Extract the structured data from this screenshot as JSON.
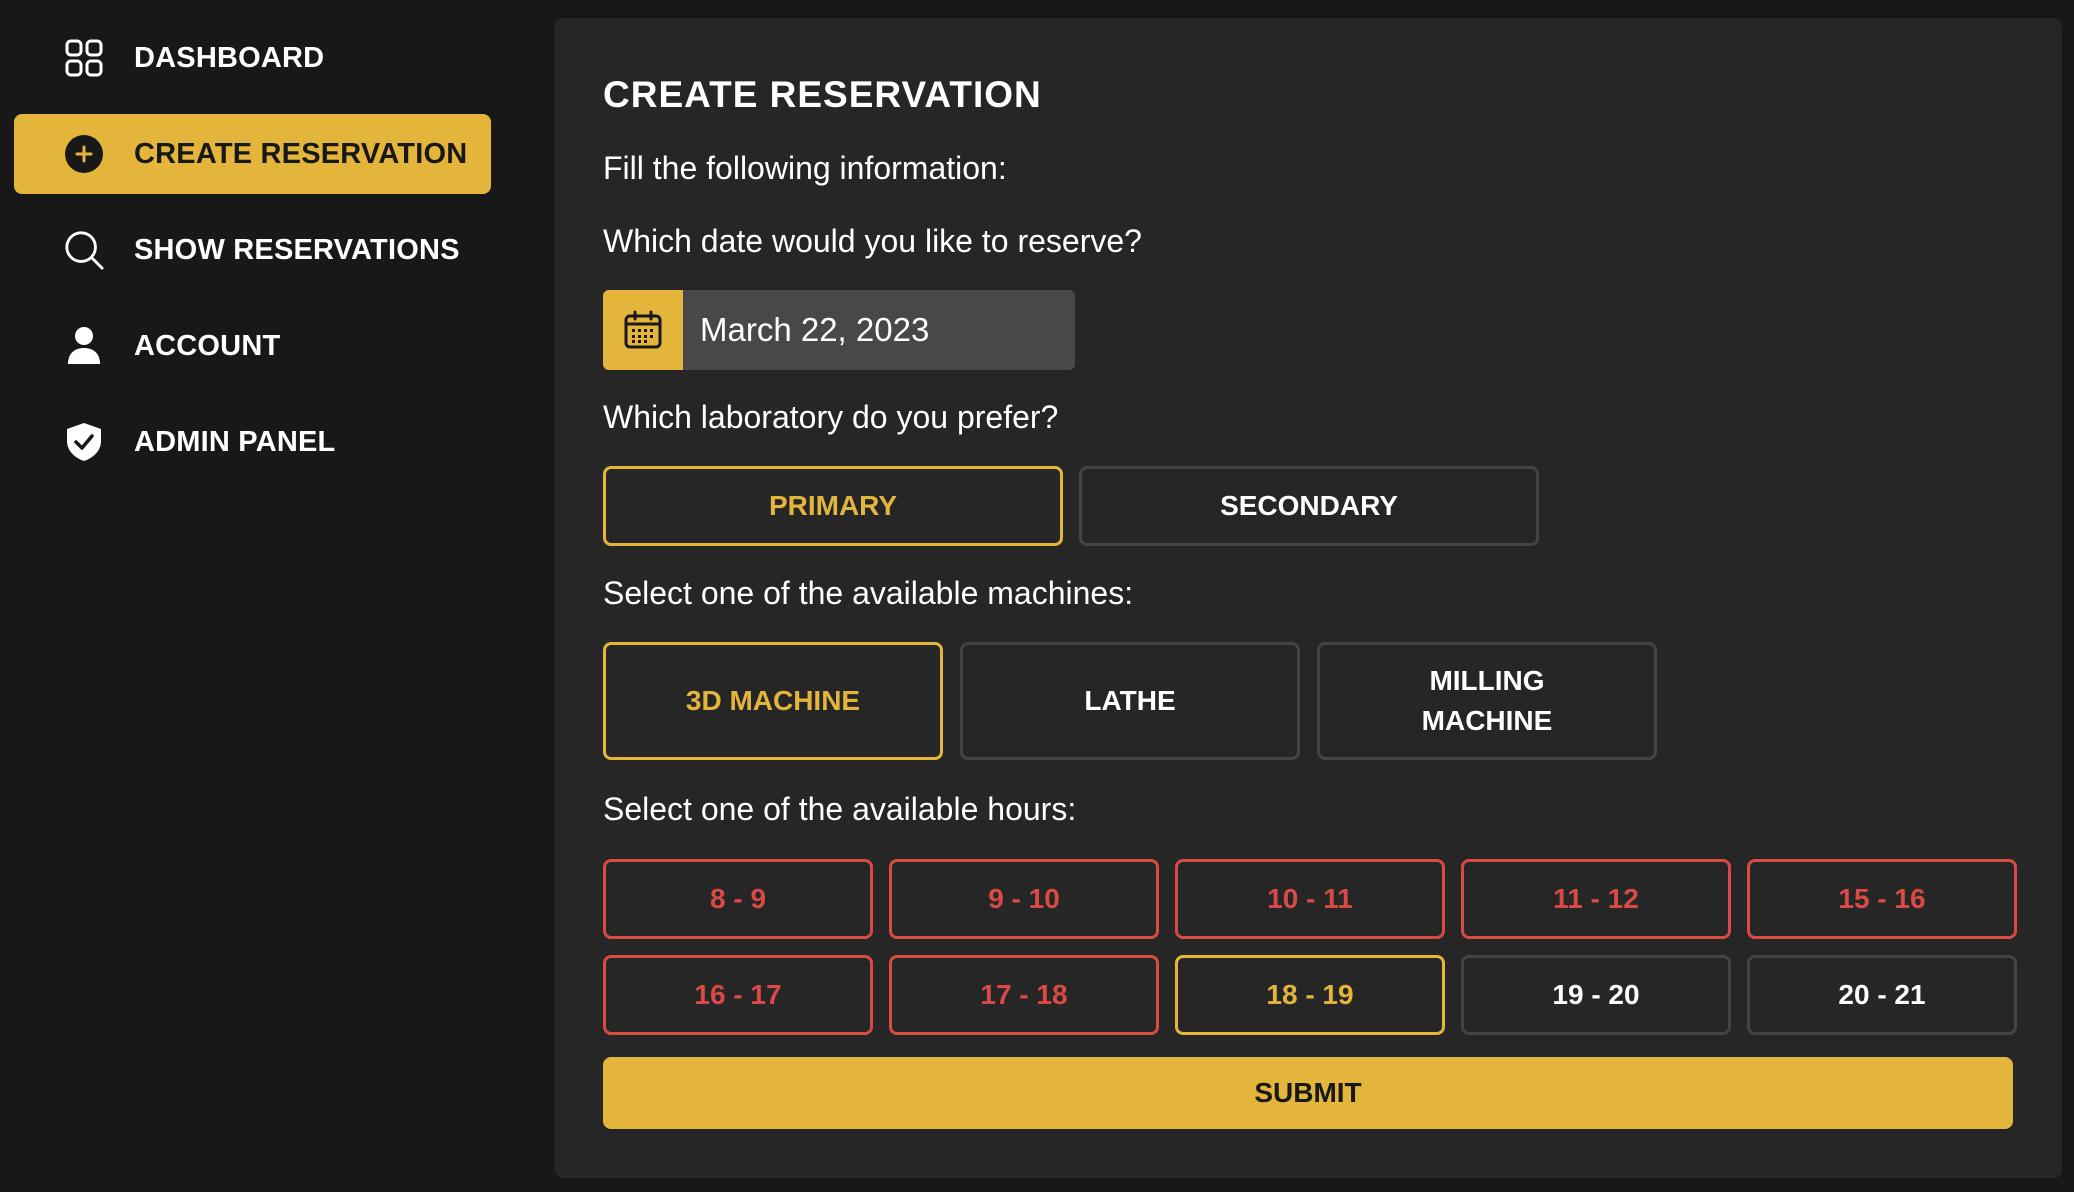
{
  "sidebar": {
    "items": [
      {
        "label": "DASHBOARD",
        "icon": "dashboard-grid-icon"
      },
      {
        "label": "CREATE RESERVATION",
        "icon": "plus-circle-icon",
        "active": true
      },
      {
        "label": "SHOW RESERVATIONS",
        "icon": "search-icon"
      },
      {
        "label": "ACCOUNT",
        "icon": "user-icon"
      },
      {
        "label": "ADMIN PANEL",
        "icon": "shield-check-icon"
      }
    ]
  },
  "form": {
    "title": "CREATE RESERVATION",
    "intro": "Fill the following information:",
    "date_question": "Which date would you like to reserve?",
    "date_value": "March 22, 2023",
    "lab_question": "Which laboratory do you prefer?",
    "labs": [
      {
        "label": "PRIMARY",
        "state": "selected"
      },
      {
        "label": "SECONDARY",
        "state": "available"
      }
    ],
    "machine_question": "Select one of the available machines:",
    "machines": [
      {
        "label": "3D MACHINE",
        "state": "selected"
      },
      {
        "label": "LATHE",
        "state": "available"
      },
      {
        "label": "MILLING MACHINE",
        "state": "available"
      }
    ],
    "hour_question": "Select one of the available hours:",
    "hours": [
      {
        "label": "8 - 9",
        "state": "taken"
      },
      {
        "label": "9 - 10",
        "state": "taken"
      },
      {
        "label": "10 - 11",
        "state": "taken"
      },
      {
        "label": "11 - 12",
        "state": "taken"
      },
      {
        "label": "15 - 16",
        "state": "taken"
      },
      {
        "label": "16 - 17",
        "state": "taken"
      },
      {
        "label": "17 - 18",
        "state": "taken"
      },
      {
        "label": "18 - 19",
        "state": "selected"
      },
      {
        "label": "19 - 20",
        "state": "available"
      },
      {
        "label": "20 - 21",
        "state": "available"
      }
    ],
    "submit_label": "SUBMIT"
  },
  "colors": {
    "accent": "#e3b53b",
    "taken": "#d94a45",
    "background": "#181818",
    "panel": "#262626"
  }
}
